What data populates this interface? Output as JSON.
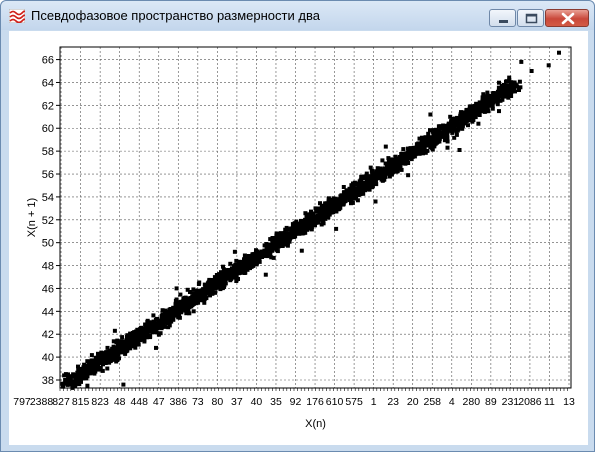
{
  "window": {
    "title": "Псевдофазовое пространство размерности два",
    "icons": {
      "app": "chart-wave-icon",
      "minimize": "minimize-icon",
      "maximize": "maximize-icon",
      "close": "close-icon"
    }
  },
  "chart_data": {
    "type": "scatter",
    "title": "",
    "xlabel": "X(n)",
    "ylabel": "X(n + 1)",
    "ylim": [
      37.3,
      67.1
    ],
    "xlim": [
      37.3,
      67.1
    ],
    "y_ticks": [
      38,
      40,
      42,
      44,
      46,
      48,
      50,
      52,
      54,
      56,
      58,
      60,
      62,
      64,
      66
    ],
    "x_tick_labels": [
      "797",
      "2388",
      "827",
      "815",
      "823",
      "48",
      "448",
      "47",
      "386",
      "73",
      "80",
      "37",
      "40",
      "35",
      "92",
      "176",
      "610",
      "575",
      "1",
      "23",
      "20",
      "258",
      "4",
      "280",
      "89",
      "231",
      "2086",
      "11",
      "13"
    ],
    "grid": true,
    "grid_style": "dashed",
    "marker": "square",
    "marker_color": "#000000",
    "trend": {
      "slope": 1.0,
      "intercept": 0.0,
      "spread": 0.55,
      "point_count": 2600
    },
    "outliers": [
      [
        38.2,
        37.6
      ],
      [
        38.9,
        37.5
      ],
      [
        41.0,
        37.6
      ],
      [
        37.6,
        38.0
      ],
      [
        37.9,
        37.6
      ],
      [
        47.5,
        49.2
      ],
      [
        44.1,
        46.0
      ],
      [
        53.4,
        51.2
      ],
      [
        55.7,
        53.6
      ],
      [
        57.6,
        55.9
      ],
      [
        63.5,
        64.2
      ],
      [
        65.8,
        65.5
      ],
      [
        66.4,
        66.6
      ],
      [
        64.2,
        65.8
      ],
      [
        60.6,
        58.1
      ],
      [
        59.9,
        58.3
      ],
      [
        61.7,
        60.4
      ],
      [
        49.3,
        47.2
      ],
      [
        51.4,
        49.3
      ],
      [
        42.9,
        40.8
      ],
      [
        56.3,
        58.4
      ],
      [
        58.9,
        61.2
      ],
      [
        64.8,
        65.0
      ],
      [
        40.5,
        42.3
      ],
      [
        62.9,
        61.5
      ]
    ]
  }
}
